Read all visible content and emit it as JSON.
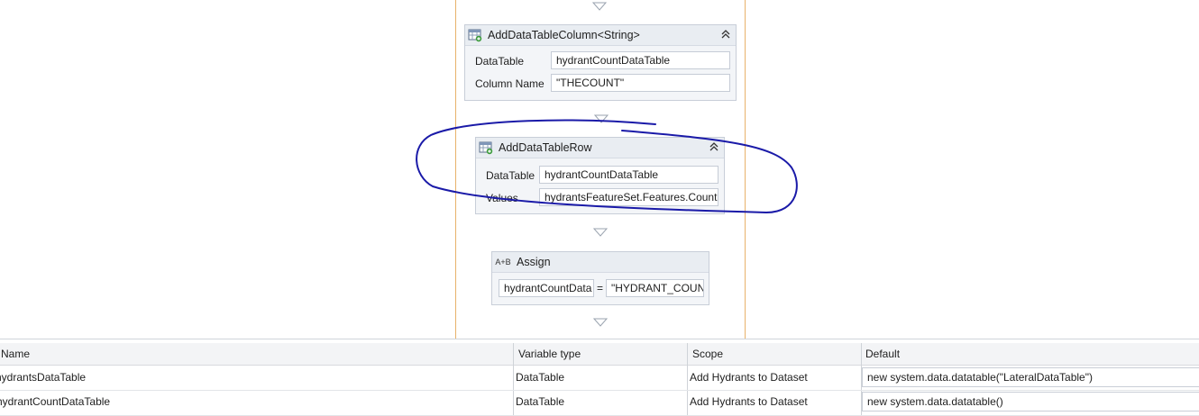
{
  "workflow": {
    "activities": [
      {
        "title": "AddDataTableColumn<String>",
        "fields": [
          {
            "label": "DataTable",
            "value": "hydrantCountDataTable"
          },
          {
            "label": "Column Name",
            "value": "\"THECOUNT\""
          }
        ]
      },
      {
        "title": "AddDataTableRow",
        "fields": [
          {
            "label": "DataTable",
            "value": "hydrantCountDataTable"
          },
          {
            "label": "Values",
            "value": "hydrantsFeatureSet.Features.Count.t"
          }
        ]
      },
      {
        "title": "Assign",
        "icon_text": "A+B",
        "to": "hydrantCountData",
        "op": "=",
        "value": "\"HYDRANT_COUN"
      }
    ]
  },
  "variables": {
    "headers": [
      "Name",
      "Variable type",
      "Scope",
      "Default"
    ],
    "rows": [
      {
        "name": "hydrantsDataTable",
        "type": "DataTable",
        "scope": "Add Hydrants to Dataset",
        "default": "new system.data.datatable(\"LateralDataTable\")"
      },
      {
        "name": "hydrantCountDataTable",
        "type": "DataTable",
        "scope": "Add Hydrants to Dataset",
        "default": "new system.data.datatable()"
      }
    ]
  },
  "colors": {
    "sequence_border": "#e8b26a",
    "activity_bg": "#f3f5f8",
    "activity_header": "#e9edf2",
    "annotation_ink": "#1a1aa8"
  },
  "icons": [
    "datatable-icon",
    "collapse-chevrons-icon",
    "flow-arrow-icon",
    "assign-icon"
  ]
}
